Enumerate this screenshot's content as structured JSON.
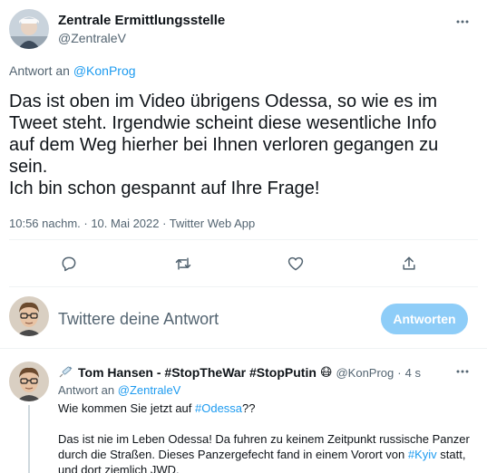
{
  "main_tweet": {
    "author_name": "Zentrale Ermittlungsstelle",
    "author_handle": "@ZentraleV",
    "reply_prefix": "Antwort an",
    "reply_to": "@KonProg",
    "text_lines": [
      "Das ist oben im Video übrigens Odessa, so wie es im",
      "Tweet steht. Irgendwie scheint diese wesentliche Info",
      "auf dem Weg hierher bei Ihnen verloren gegangen zu",
      "sein.",
      "Ich bin schon gespannt auf Ihre Frage!"
    ],
    "timestamp": "10:56 nachm. · 10. Mai 2022 · Twitter Web App",
    "actions": [
      "reply-icon",
      "retweet-icon",
      "like-icon",
      "share-icon"
    ]
  },
  "compose": {
    "placeholder": "Twittere deine Antwort",
    "button_label": "Antworten"
  },
  "reply_tweet": {
    "author_name": "Tom Hansen - #StopTheWar #StopPutin",
    "author_emoji": "😷",
    "author_handle": "@KonProg",
    "time_sep": "·",
    "time": "4 s",
    "reply_prefix": "Antwort an",
    "reply_to": "@ZentraleV",
    "line1_prefix": "Wie kommen Sie jetzt auf ",
    "line1_hashtag": "#Odessa",
    "line1_suffix": "??",
    "line2": "Das ist nie im Leben Odessa! Da fuhren zu keinem Zeitpunkt russische Panzer",
    "line3_prefix": "durch die Straßen. Dieses Panzergefecht fand in einem Vorort von ",
    "line3_hashtag": "#Kyiv",
    "line3_suffix": " statt,",
    "line4": "und dort ziemlich JWD."
  },
  "colors": {
    "accent": "#1d9bf0",
    "button_disabled": "#8ecdf8",
    "secondary_text": "#536471"
  }
}
